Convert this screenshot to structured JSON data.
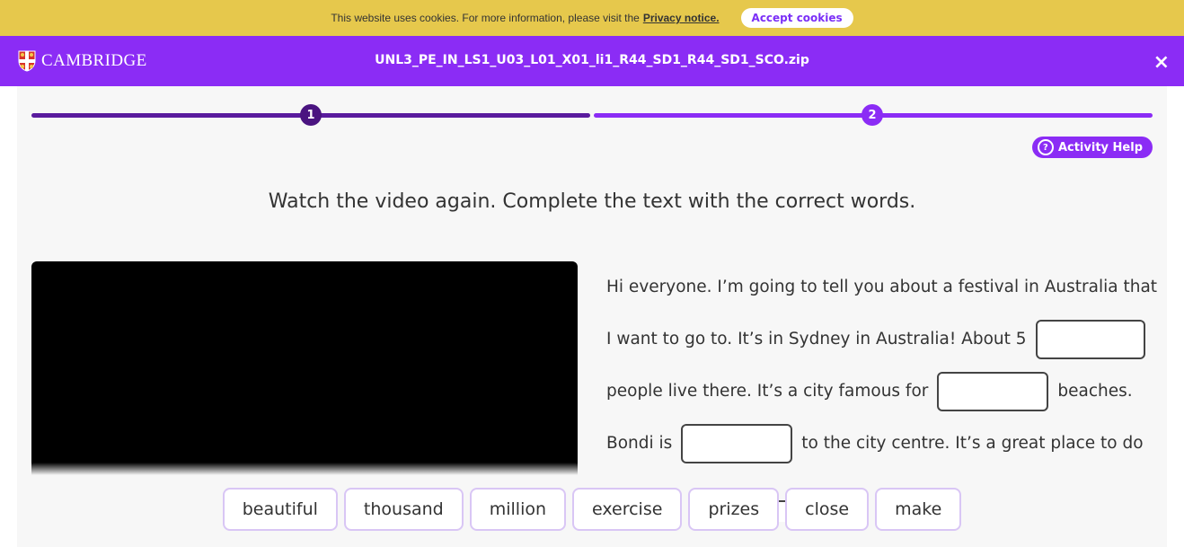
{
  "cookie": {
    "message": "This website uses cookies. For more information, please visit the",
    "link": "Privacy notice.",
    "accept": "Accept cookies"
  },
  "header": {
    "brand": "CAMBRIDGE",
    "filename": "UNL3_PE_IN_LS1_U03_L01_X01_li1_R44_SD1_R44_SD1_SCO.zip",
    "close": "×"
  },
  "progress": {
    "steps": [
      "1",
      "2"
    ],
    "current_step": 2
  },
  "activity_help": {
    "label": "Activity Help",
    "icon": "?"
  },
  "instructions": "Watch the video again. Complete the text with the correct words.",
  "passage": {
    "line1": "Hi everyone. I’m going to tell you about a festival in Australia that",
    "line2": "I want to go to. It’s in Sydney in Australia! About 5",
    "line3a": "people live there. It’s a city famous for",
    "line3b": "beaches.",
    "line4a": "Bondi is",
    "line4b": "to the city centre. It’s a great place to do"
  },
  "word_bank": [
    "beautiful",
    "thousand",
    "million",
    "exercise",
    "prizes",
    "close",
    "make"
  ],
  "colors": {
    "brand_purple": "#8b2cf5",
    "cookie_yellow": "#e6c84c",
    "dark_purple": "#5a1b9e"
  }
}
